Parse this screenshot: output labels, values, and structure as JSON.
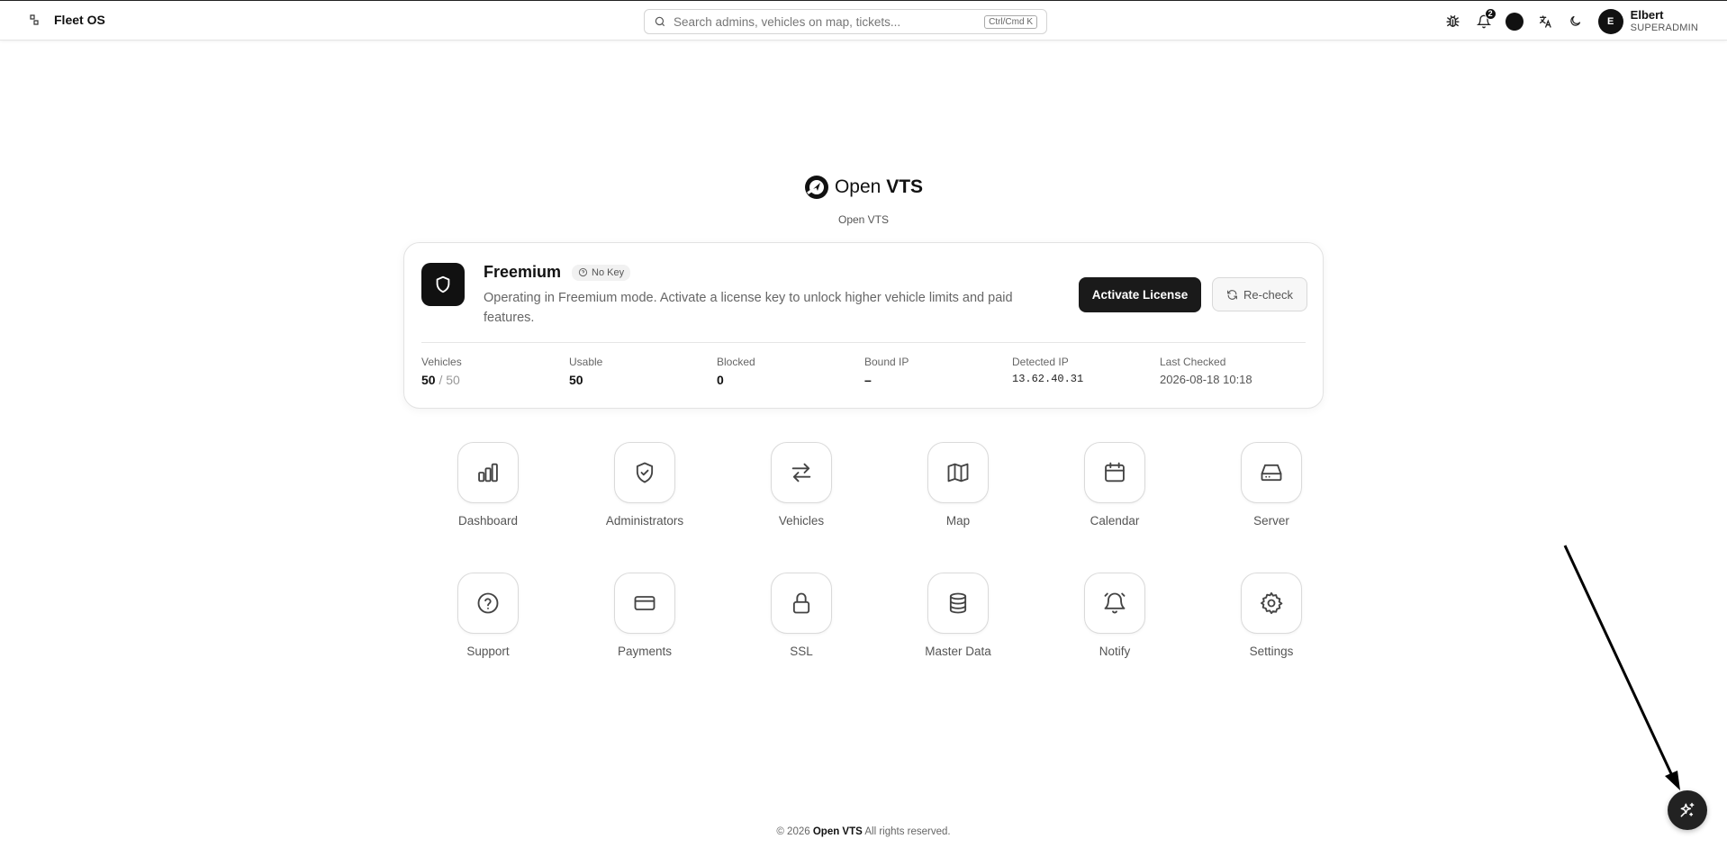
{
  "header": {
    "app_name": "Fleet OS",
    "search_placeholder": "Search admins, vehicles on map, tickets...",
    "search_shortcut": "Ctrl/Cmd K",
    "notification_count": "2",
    "user": {
      "initial": "E",
      "name": "Elbert",
      "role": "SUPERADMIN"
    },
    "icons": [
      "bug-icon",
      "bell-icon",
      "theme-dot-icon",
      "translate-icon",
      "moon-icon"
    ]
  },
  "brand": {
    "logo_text_light": "Open ",
    "logo_text_bold": "VTS",
    "subtitle": "Open VTS"
  },
  "license": {
    "plan": "Freemium",
    "key_status": "No Key",
    "description": "Operating in Freemium mode. Activate a license key to unlock higher vehicle limits and paid features.",
    "activate_label": "Activate License",
    "recheck_label": "Re-check",
    "stats": {
      "vehicles_label": "Vehicles",
      "vehicles_used": "50",
      "vehicles_total": "/ 50",
      "usable_label": "Usable",
      "usable_value": "50",
      "blocked_label": "Blocked",
      "blocked_value": "0",
      "bound_ip_label": "Bound IP",
      "bound_ip_value": "–",
      "detected_ip_label": "Detected IP",
      "detected_ip_value": "13.62.40.31",
      "last_checked_label": "Last Checked",
      "last_checked_value": "2026-08-18 10:18"
    }
  },
  "modules": [
    {
      "label": "Dashboard",
      "icon": "bar-chart-icon"
    },
    {
      "label": "Administrators",
      "icon": "shield-check-icon"
    },
    {
      "label": "Vehicles",
      "icon": "arrows-swap-icon"
    },
    {
      "label": "Map",
      "icon": "map-icon"
    },
    {
      "label": "Calendar",
      "icon": "calendar-icon"
    },
    {
      "label": "Server",
      "icon": "hard-drive-icon"
    },
    {
      "label": "Support",
      "icon": "help-circle-icon"
    },
    {
      "label": "Payments",
      "icon": "credit-card-icon"
    },
    {
      "label": "SSL",
      "icon": "lock-icon"
    },
    {
      "label": "Master Data",
      "icon": "database-icon"
    },
    {
      "label": "Notify",
      "icon": "bell-ring-icon"
    },
    {
      "label": "Settings",
      "icon": "gear-icon"
    }
  ],
  "footer": {
    "prefix": "© 2026 ",
    "brand": "Open VTS",
    "suffix": " All rights reserved."
  }
}
